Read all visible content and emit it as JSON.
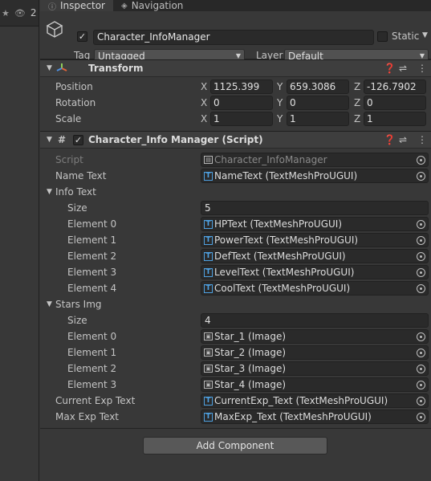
{
  "left_panel": {
    "count": "2"
  },
  "tabs": [
    {
      "label": "Inspector",
      "icon": "info-icon"
    },
    {
      "label": "Navigation",
      "icon": "navigation-icon"
    }
  ],
  "object": {
    "active": "✓",
    "name": "Character_InfoManager",
    "static_label": "Static",
    "tag_label": "Tag",
    "tag_value": "Untagged",
    "layer_label": "Layer",
    "layer_value": "Default"
  },
  "transform": {
    "title": "Transform",
    "rows": [
      {
        "label": "Position",
        "x": "1125.399",
        "y": "659.3086",
        "z": "-126.7902"
      },
      {
        "label": "Rotation",
        "x": "0",
        "y": "0",
        "z": "0"
      },
      {
        "label": "Scale",
        "x": "1",
        "y": "1",
        "z": "1"
      }
    ],
    "axes": {
      "x": "X",
      "y": "Y",
      "z": "Z"
    }
  },
  "script_component": {
    "enabled": "✓",
    "title": "Character_Info Manager (Script)",
    "script_label": "Script",
    "script_value": "Character_InfoManager",
    "name_text_label": "Name Text",
    "name_text_value": "NameText (TextMeshProUGUI)",
    "info_text": {
      "label": "Info Text",
      "size_label": "Size",
      "size": "5",
      "elements": [
        {
          "label": "Element 0",
          "value": "HPText (TextMeshProUGUI)"
        },
        {
          "label": "Element 1",
          "value": "PowerText (TextMeshProUGUI)"
        },
        {
          "label": "Element 2",
          "value": "DefText (TextMeshProUGUI)"
        },
        {
          "label": "Element 3",
          "value": "LevelText (TextMeshProUGUI)"
        },
        {
          "label": "Element 4",
          "value": "CoolText (TextMeshProUGUI)"
        }
      ]
    },
    "stars_img": {
      "label": "Stars Img",
      "size_label": "Size",
      "size": "4",
      "elements": [
        {
          "label": "Element 0",
          "value": "Star_1 (Image)"
        },
        {
          "label": "Element 1",
          "value": "Star_2 (Image)"
        },
        {
          "label": "Element 2",
          "value": "Star_3 (Image)"
        },
        {
          "label": "Element 3",
          "value": "Star_4 (Image)"
        }
      ]
    },
    "current_exp_label": "Current Exp Text",
    "current_exp_value": "CurrentExp_Text (TextMeshProUGUI)",
    "max_exp_label": "Max Exp Text",
    "max_exp_value": "MaxExp_Text (TextMeshProUGUI)"
  },
  "add_component_label": "Add Component",
  "icons": {
    "text_icon": "T",
    "image_icon": "▣"
  }
}
